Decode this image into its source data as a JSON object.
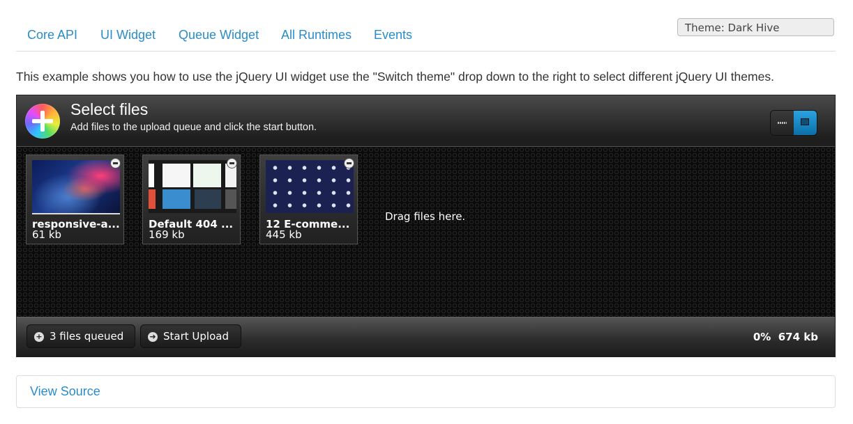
{
  "nav": {
    "tabs": [
      "Core API",
      "UI Widget",
      "Queue Widget",
      "All Runtimes",
      "Events"
    ]
  },
  "theme_select": {
    "value": "Theme: Dark Hive"
  },
  "intro_text": "This example shows you how to use the jQuery UI widget use the \"Switch theme\" drop down to the right to select different jQuery UI themes.",
  "uploader": {
    "title": "Select files",
    "subtitle": "Add files to the upload queue and click the start button.",
    "view_modes": [
      "list-view-icon",
      "thumbnails-view-icon"
    ],
    "active_view": "thumbnails",
    "drop_text": "Drag files here.",
    "files": [
      {
        "name": "responsive-a...",
        "size": "61 kb"
      },
      {
        "name": "Default 404 ...",
        "size": "169 kb"
      },
      {
        "name": "12 E-comme...",
        "size": "445 kb"
      }
    ],
    "footer": {
      "queued_label": "3 files queued",
      "start_label": "Start Upload",
      "percent": "0%",
      "total_size": "674 kb"
    }
  },
  "view_source": {
    "label": "View Source"
  },
  "colors": {
    "link": "#2a8cc8",
    "accent": "#1a8ad0"
  }
}
